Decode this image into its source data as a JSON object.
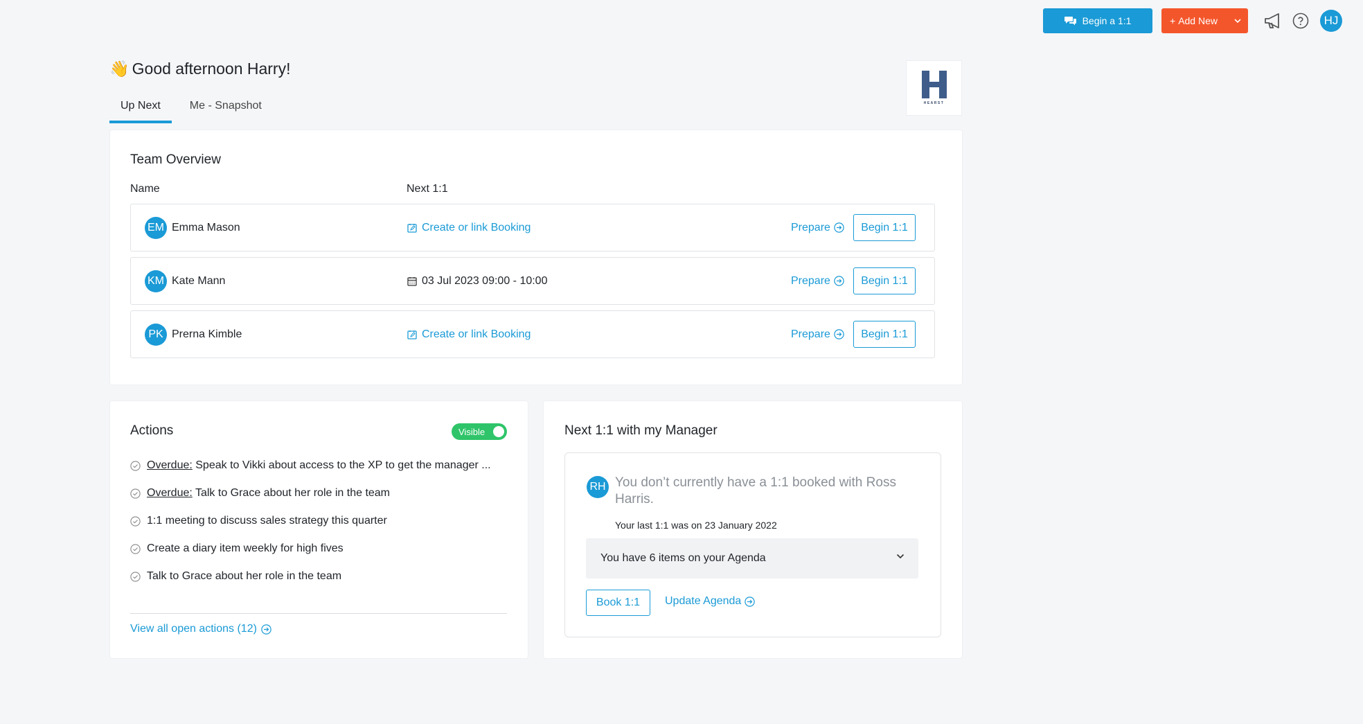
{
  "topbar": {
    "begin_label": "Begin a 1:1",
    "add_new_label": "Add New",
    "user_initials": "HJ"
  },
  "greeting": {
    "emoji": "👋",
    "text": "Good afternoon Harry!"
  },
  "tabs": [
    {
      "label": "Up Next",
      "active": true
    },
    {
      "label": "Me - Snapshot",
      "active": false
    }
  ],
  "logo": {
    "letter": "H",
    "word": "HEARST"
  },
  "team": {
    "title": "Team Overview",
    "col_name": "Name",
    "col_next": "Next 1:1",
    "rows": [
      {
        "initials": "EM",
        "name": "Emma Mason",
        "booking": "Create or link Booking",
        "booking_linked": false,
        "prepare": "Prepare",
        "begin": "Begin 1:1"
      },
      {
        "initials": "KM",
        "name": "Kate Mann",
        "booking": "03 Jul 2023 09:00 - 10:00",
        "booking_linked": true,
        "prepare": "Prepare",
        "begin": "Begin 1:1"
      },
      {
        "initials": "PK",
        "name": "Prerna Kimble",
        "booking": "Create or link Booking",
        "booking_linked": false,
        "prepare": "Prepare",
        "begin": "Begin 1:1"
      }
    ]
  },
  "actions": {
    "title": "Actions",
    "toggle_label": "Visible",
    "toggle_on": true,
    "items": [
      {
        "prefix": "Overdue:",
        "text": " Speak to Vikki about access to the XP to get the manager ..."
      },
      {
        "prefix": "Overdue:",
        "text": " Talk to Grace about her role in the team"
      },
      {
        "prefix": "",
        "text": "1:1 meeting to discuss sales strategy this quarter"
      },
      {
        "prefix": "",
        "text": "Create a diary item weekly for high fives"
      },
      {
        "prefix": "",
        "text": "Talk to Grace about her role in the team"
      }
    ],
    "view_all": "View all open actions (12)"
  },
  "manager": {
    "title": "Next 1:1 with my Manager",
    "initials": "RH",
    "message": "You don’t currently have a 1:1 booked with Ross Harris.",
    "last": "Your last 1:1 was on 23 January 2022",
    "agenda": "You have 6 items on your Agenda",
    "book": "Book 1:1",
    "update": "Update Agenda"
  },
  "colors": {
    "accent": "#1a9ad6",
    "add_new": "#f4562b",
    "toggle": "#2fc469"
  }
}
